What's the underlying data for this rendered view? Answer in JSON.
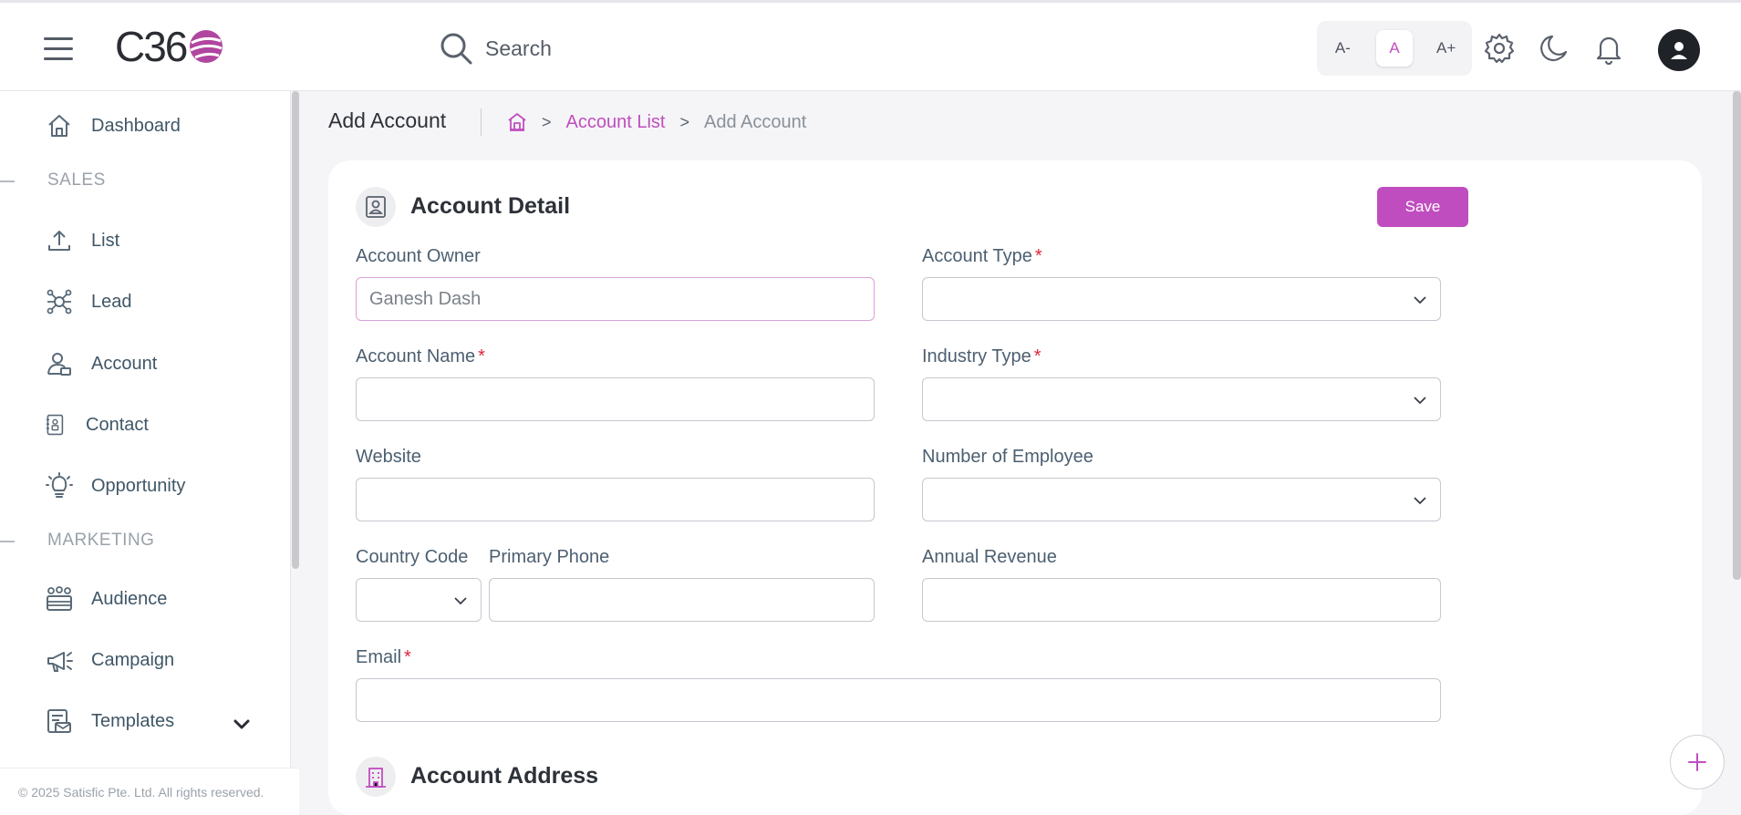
{
  "header": {
    "logo_text": "C36",
    "search_placeholder": "Search",
    "font_controls": [
      "A-",
      "A",
      "A+"
    ],
    "icons": [
      "hamburger-icon",
      "search-icon",
      "gear-icon",
      "moon-icon",
      "bell-icon",
      "user-avatar-icon"
    ]
  },
  "sidebar": {
    "items": [
      {
        "label": "Dashboard",
        "icon": "home-icon"
      },
      {
        "label": "List",
        "icon": "upload-icon"
      },
      {
        "label": "Lead",
        "icon": "network-icon"
      },
      {
        "label": "Account",
        "icon": "account-icon"
      },
      {
        "label": "Contact",
        "icon": "contact-icon"
      },
      {
        "label": "Opportunity",
        "icon": "lightbulb-icon"
      },
      {
        "label": "Audience",
        "icon": "audience-icon"
      },
      {
        "label": "Campaign",
        "icon": "megaphone-icon"
      },
      {
        "label": "Templates",
        "icon": "templates-icon"
      }
    ],
    "sections": [
      "SALES",
      "MARKETING"
    ],
    "footer": "© 2025 Satisfic Pte. Ltd. All rights reserved."
  },
  "page": {
    "title": "Add Account",
    "breadcrumb": [
      "Account List",
      "Add Account"
    ],
    "breadcrumb_separator": ">"
  },
  "form": {
    "section_title": "Account Detail",
    "save_label": "Save",
    "account_owner_label": "Account Owner",
    "account_owner_value": "Ganesh Dash",
    "account_type_label": "Account Type",
    "account_name_label": "Account Name",
    "industry_type_label": "Industry Type",
    "website_label": "Website",
    "employees_label": "Number of Employee",
    "country_code_label": "Country Code",
    "primary_phone_label": "Primary Phone",
    "annual_revenue_label": "Annual Revenue",
    "email_label": "Email",
    "required_marker": "*",
    "address_section_title": "Account Address"
  },
  "colors": {
    "accent": "#c04dbf",
    "required": "#e0243b",
    "text": "#3d4451"
  }
}
